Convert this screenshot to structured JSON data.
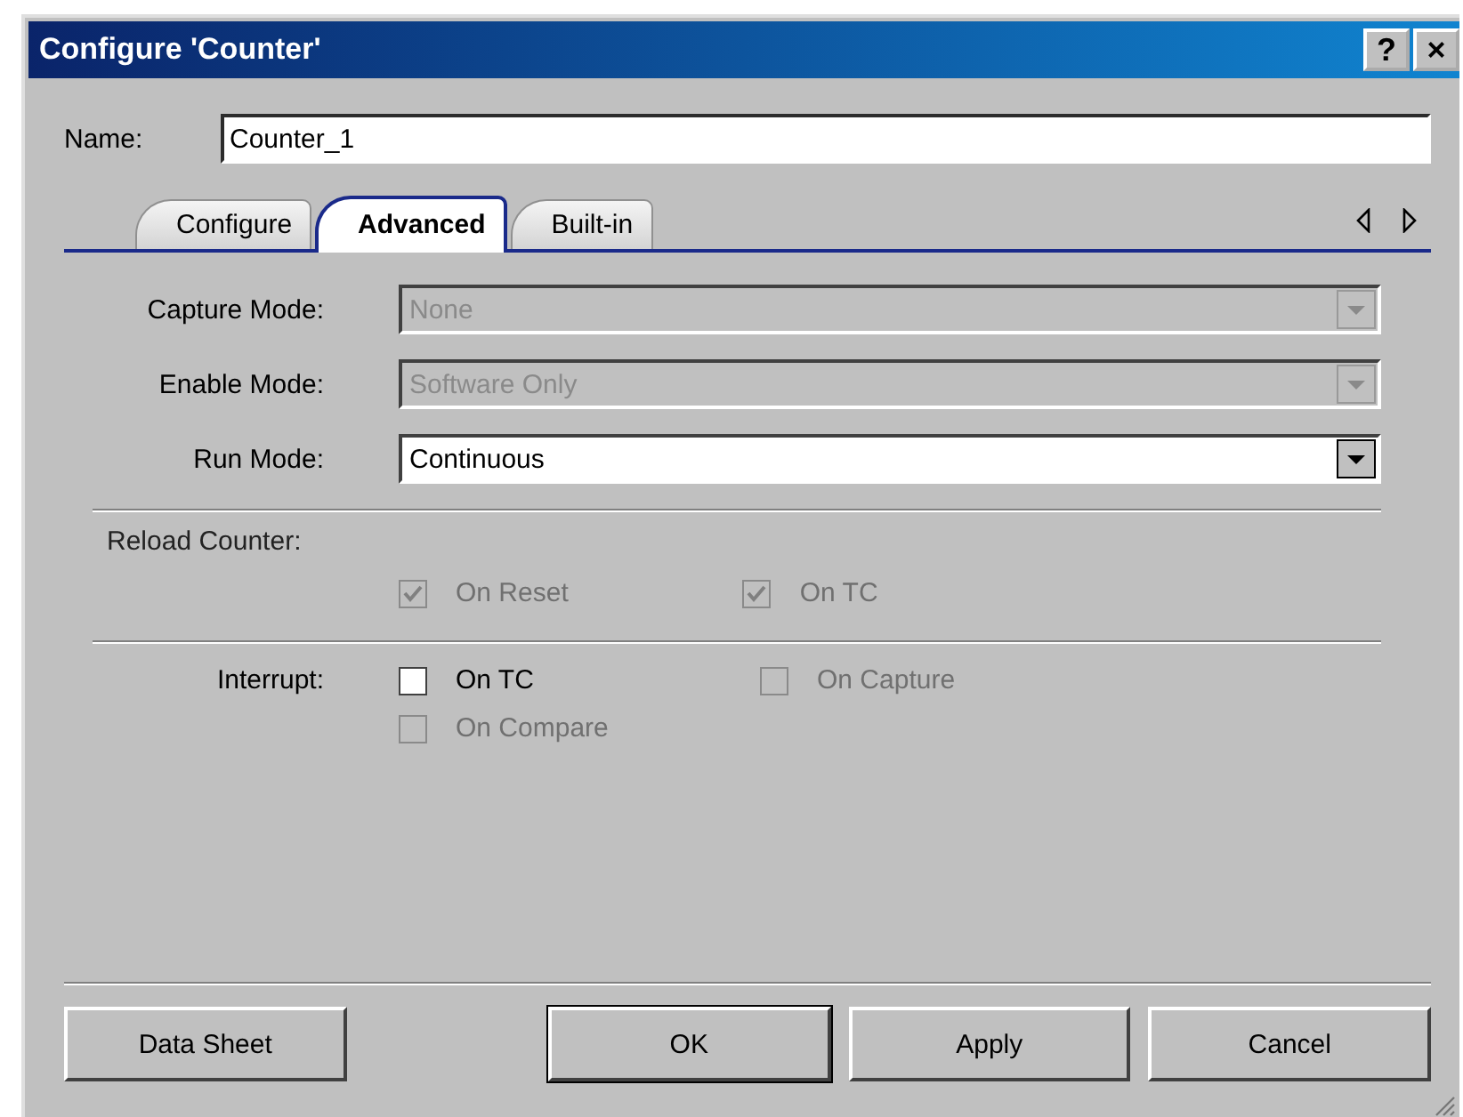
{
  "window": {
    "title": "Configure 'Counter'",
    "help_button": "?",
    "close_button": "×"
  },
  "name_field": {
    "label": "Name:",
    "value": "Counter_1"
  },
  "tabs": [
    {
      "label": "Configure",
      "selected": false
    },
    {
      "label": "Advanced",
      "selected": true
    },
    {
      "label": "Built-in",
      "selected": false
    }
  ],
  "modes": [
    {
      "label": "Capture Mode:",
      "value": "None",
      "disabled": true
    },
    {
      "label": "Enable Mode:",
      "value": "Software Only",
      "disabled": true
    },
    {
      "label": "Run Mode:",
      "value": "Continuous",
      "disabled": false
    }
  ],
  "reload_counter": {
    "label": "Reload Counter:",
    "options": [
      {
        "label": "On Reset",
        "checked": true,
        "disabled": true
      },
      {
        "label": "On TC",
        "checked": true,
        "disabled": true
      }
    ]
  },
  "interrupt": {
    "label": "Interrupt:",
    "options": [
      {
        "label": "On TC",
        "checked": false,
        "disabled": false
      },
      {
        "label": "On Capture",
        "checked": false,
        "disabled": true
      },
      {
        "label": "On Compare",
        "checked": false,
        "disabled": true
      }
    ]
  },
  "buttons": [
    {
      "label": "Data Sheet",
      "default": false
    },
    {
      "label": "OK",
      "default": true
    },
    {
      "label": "Apply",
      "default": false
    },
    {
      "label": "Cancel",
      "default": false
    }
  ]
}
